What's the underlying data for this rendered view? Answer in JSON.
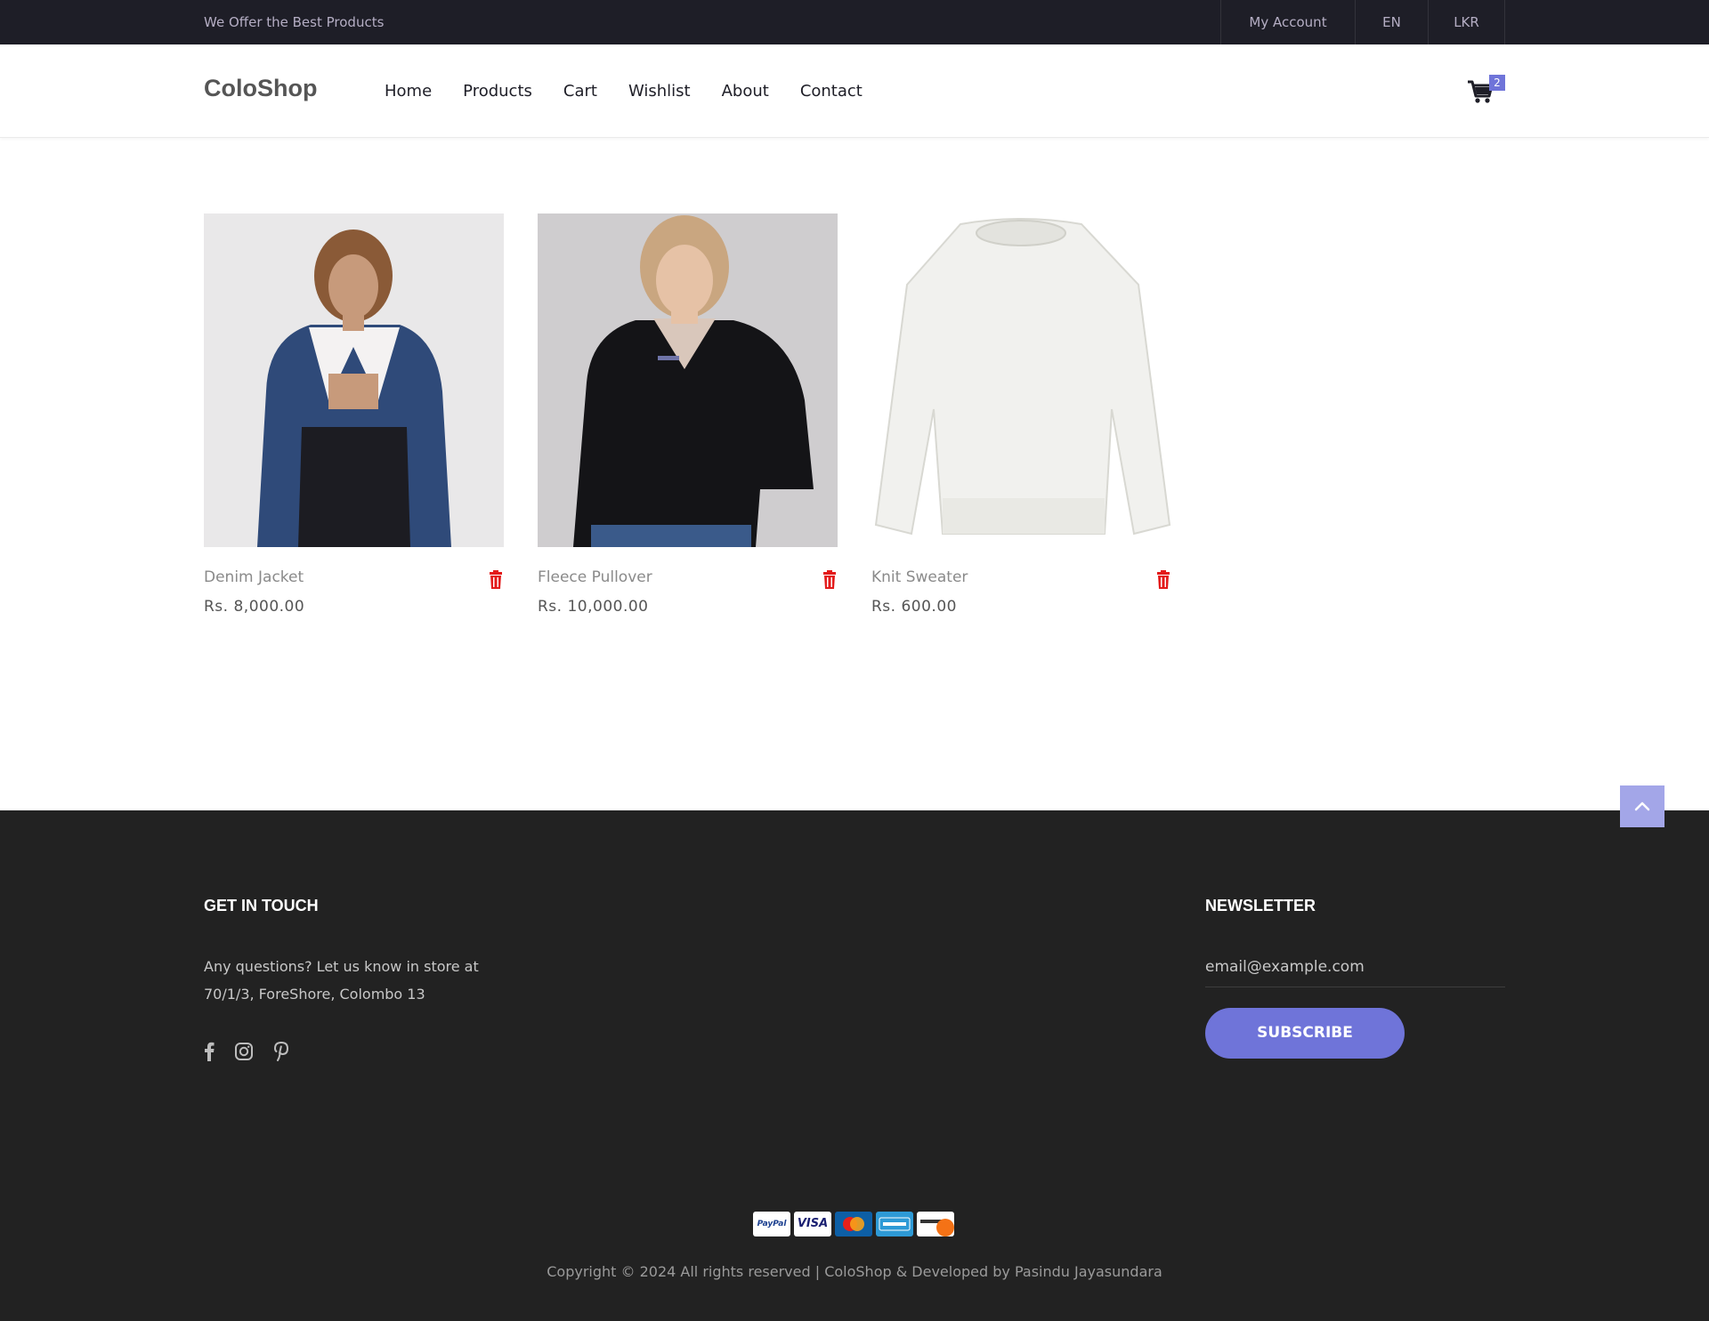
{
  "topbar": {
    "tagline": "We Offer the Best Products",
    "account": "My Account",
    "language": "EN",
    "currency": "LKR"
  },
  "nav": {
    "logo": "ColoShop",
    "links": [
      "Home",
      "Products",
      "Cart",
      "Wishlist",
      "About",
      "Contact"
    ],
    "cart_count": "2",
    "cart_icon": "shopping-cart-icon"
  },
  "products": [
    {
      "name": "Denim Jacket",
      "price": "Rs. 8,000.00",
      "image": "woman-in-denim-jacket-photo"
    },
    {
      "name": "Fleece Pullover",
      "price": "Rs. 10,000.00",
      "image": "woman-in-black-fleece-pullover-photo"
    },
    {
      "name": "Knit Sweater",
      "price": "Rs. 600.00",
      "image": "white-knit-sweater-photo"
    }
  ],
  "footer": {
    "contact_heading": "GET IN TOUCH",
    "contact_line1": "Any questions? Let us know in store at",
    "contact_line2": "70/1/3, ForeShore, Colombo 13",
    "socials": [
      "facebook-icon",
      "instagram-icon",
      "pinterest-icon"
    ],
    "newsletter_heading": "NEWSLETTER",
    "newsletter_placeholder": "email@example.com",
    "subscribe_label": "SUBSCRIBE",
    "payment_methods": [
      "PayPal",
      "VISA",
      "MasterCard",
      "American Express",
      "Discover"
    ],
    "copyright": "Copyright © 2024 All rights reserved | ColoShop & Developed by Pasindu Jayasundara"
  },
  "colors": {
    "accent": "#6f74d9",
    "dark": "#1e1e27",
    "footer_bg": "#222222",
    "delete_red": "#e31b1b"
  }
}
